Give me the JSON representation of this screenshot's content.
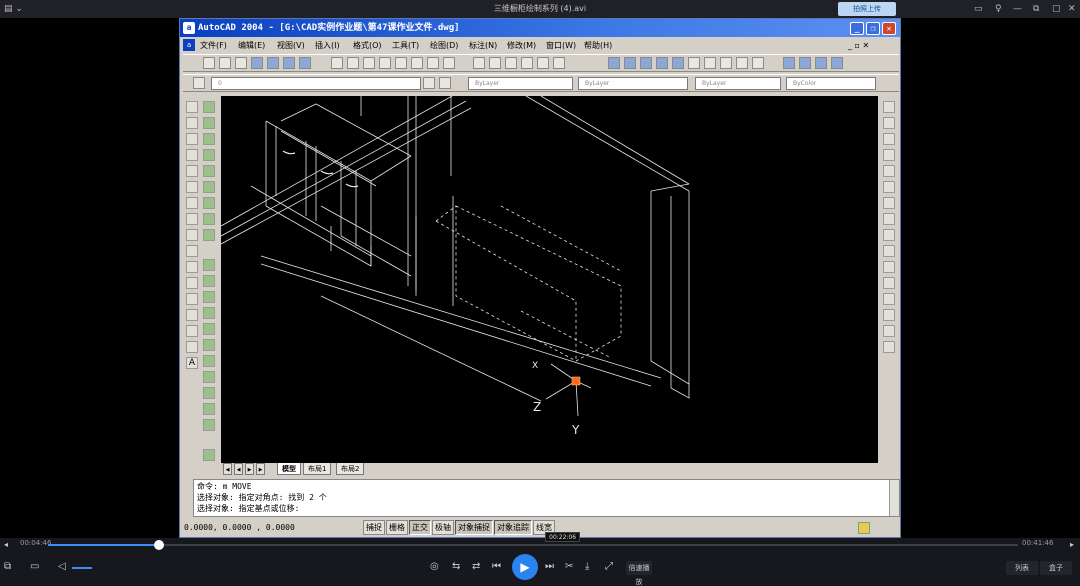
{
  "player": {
    "title": "三维橱柜绘制系列 (4).avi",
    "upload_label": "拍照上传",
    "current_time": "00:04:46",
    "total_time": "00:41:46",
    "hover_time": "00:22:06",
    "progress": 0.114,
    "hover_position": 0.529,
    "speed_label": "倍速播放",
    "playlist_label": "列表",
    "settings_label": "盒子"
  },
  "acad": {
    "title": "AutoCAD 2004 - [G:\\CAD实例作业题\\第47课作业文件.dwg]",
    "menu": [
      "文件(F)",
      "编辑(E)",
      "视图(V)",
      "插入(I)",
      "格式(O)",
      "工具(T)",
      "绘图(D)",
      "标注(N)",
      "修改(M)",
      "窗口(W)",
      "帮助(H)"
    ],
    "layer_value": "0",
    "color_value": "ByLayer",
    "linetype_value": "ByLayer",
    "lineweight_value": "ByLayer",
    "plotstyle_value": "ByColor",
    "tabs": [
      "模型",
      "布局1",
      "布局2"
    ],
    "ucs": {
      "x": "X",
      "y": "Y",
      "z": "Z"
    },
    "command_lines": [
      "命令: m MOVE",
      "选择对象: 指定对角点: 找到 2 个",
      "选择对象:  指定基点或位移:"
    ],
    "coords": "0.0000,   0.0000   , 0.0000",
    "status_buttons": [
      "捕捉",
      "栅格",
      "正交",
      "极轴",
      "对象捕捉",
      "对象追踪",
      "线宽"
    ]
  }
}
